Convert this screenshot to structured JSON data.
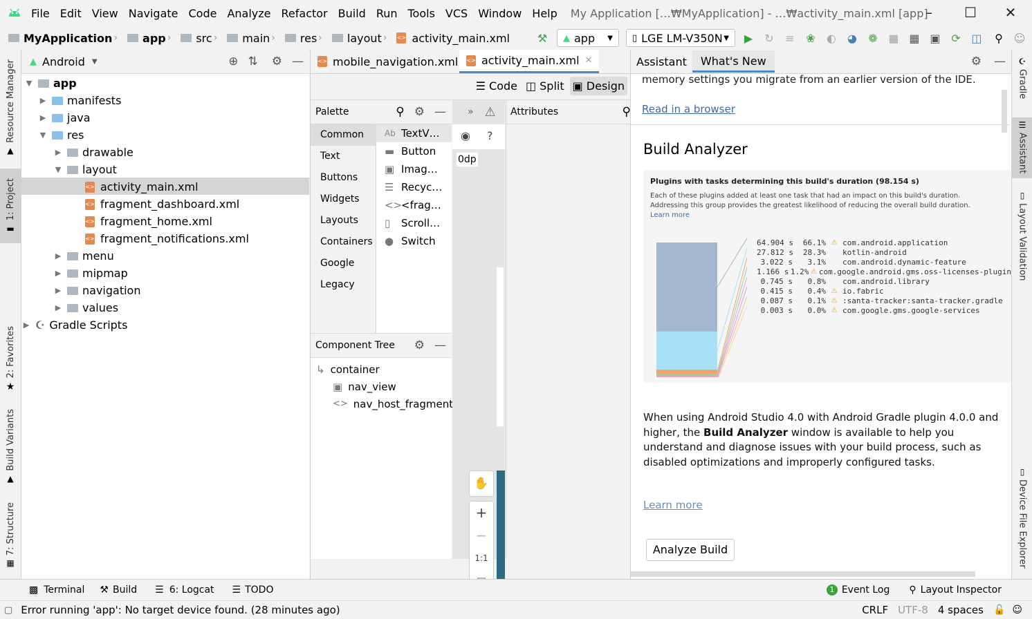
{
  "menu": [
    "File",
    "Edit",
    "View",
    "Navigate",
    "Code",
    "Analyze",
    "Refactor",
    "Build",
    "Run",
    "Tools",
    "VCS",
    "Window",
    "Help"
  ],
  "window_title": "My Application […₩MyApplication] - …₩activity_main.xml [app]",
  "breadcrumb": [
    "MyApplication",
    "app",
    "src",
    "main",
    "res",
    "layout",
    "activity_main.xml"
  ],
  "toolbar": {
    "run_config": "app",
    "device": "LGE LM-V350N"
  },
  "left_tabs": {
    "resource_manager": "Resource Manager",
    "project": "1: Project",
    "favorites": "2: Favorites",
    "build_variants": "Build Variants",
    "structure": "7: Structure"
  },
  "right_tabs": {
    "gradle": "Gradle",
    "assistant": "Assistant",
    "layout_validation": "Layout Validation",
    "device_file_explorer": "Device File Explorer"
  },
  "project": {
    "view_mode": "Android",
    "tree": {
      "app": "app",
      "manifests": "manifests",
      "java": "java",
      "res": "res",
      "drawable": "drawable",
      "layout": "layout",
      "activity_main": "activity_main.xml",
      "fragment_dashboard": "fragment_dashboard.xml",
      "fragment_home": "fragment_home.xml",
      "fragment_notifications": "fragment_notifications.xml",
      "menu": "menu",
      "mipmap": "mipmap",
      "navigation": "navigation",
      "values": "values",
      "gradle": "Gradle Scripts"
    }
  },
  "editor_tabs": [
    "mobile_navigation.xml",
    "activity_main.xml"
  ],
  "view_modes": {
    "code": "Code",
    "split": "Split",
    "design": "Design"
  },
  "palette": {
    "title": "Palette",
    "categories": [
      "Common",
      "Text",
      "Buttons",
      "Widgets",
      "Layouts",
      "Containers",
      "Google",
      "Legacy"
    ],
    "items": [
      "TextV…",
      "Button",
      "Imag…",
      "Recyc…",
      "<frag…",
      "Scroll…",
      "Switch"
    ]
  },
  "attributes_title": "Attributes",
  "dp_label": "0dp",
  "zoom": {
    "plus": "+",
    "minus": "−",
    "ratio": "1:1"
  },
  "component_tree": {
    "title": "Component Tree",
    "items": [
      "container",
      "nav_view",
      "nav_host_fragment"
    ]
  },
  "assistant": {
    "tabs": [
      "Assistant",
      "What's New"
    ],
    "intro": "memory settings you migrate from an earlier version of the IDE.",
    "read_link": "Read in a browser",
    "heading": "Build Analyzer",
    "figure": {
      "title": "Plugins with tasks determining this build's duration (98.154 s)",
      "desc1": "Each of these plugins added at least one task that had an impact on this build's duration.",
      "desc2": "Addressing this group provides the greatest likelihood of reducing the overall build duration.",
      "learn": "Learn more",
      "rows": [
        {
          "time": "64.904 s",
          "pct": "66.1%",
          "warn": true,
          "name": "com.android.application",
          "color": "#a3b8cc"
        },
        {
          "time": "27.812 s",
          "pct": "28.3%",
          "warn": false,
          "name": "kotlin-android",
          "color": "#a8e1f7"
        },
        {
          "time": "3.022 s",
          "pct": "3.1%",
          "warn": false,
          "name": "com.android.dynamic-feature",
          "color": "#f2a36a"
        },
        {
          "time": "1.166 s",
          "pct": "1.2%",
          "warn": true,
          "name": "com.google.android.gms.oss-licenses-plugin",
          "color": "#8fd19e"
        },
        {
          "time": "0.745 s",
          "pct": "0.8%",
          "warn": false,
          "name": "com.android.library",
          "color": "#f49ac1"
        },
        {
          "time": "0.415 s",
          "pct": "0.4%",
          "warn": true,
          "name": "io.fabric",
          "color": "#c8a2e8"
        },
        {
          "time": "0.087 s",
          "pct": "0.1%",
          "warn": true,
          "name": ":santa-tracker:santa-tracker.gradle",
          "color": "#f5c17e"
        },
        {
          "time": "0.003 s",
          "pct": "0.0%",
          "warn": true,
          "name": "com.google.gms.google-services",
          "color": "#f7d6a8"
        }
      ]
    },
    "para_pre": "When using Android Studio 4.0 with Android Gradle plugin 4.0.0 and higher, the ",
    "para_bold": "Build Analyzer",
    "para_post": " window is available to help you understand and diagnose issues with your build process, such as disabled optimizations and improperly configured tasks.",
    "learn_more": "Learn more",
    "button": "Analyze Build"
  },
  "bottom_tabs": {
    "terminal": "Terminal",
    "build": "Build",
    "logcat": "6: Logcat",
    "todo": "TODO",
    "event_log": "Event Log",
    "layout_inspector": "Layout Inspector",
    "event_count": "1"
  },
  "status": {
    "message": "Error running 'app': No target device found. (28 minutes ago)",
    "line_sep": "CRLF",
    "encoding": "UTF-8",
    "indent": "4 spaces"
  }
}
